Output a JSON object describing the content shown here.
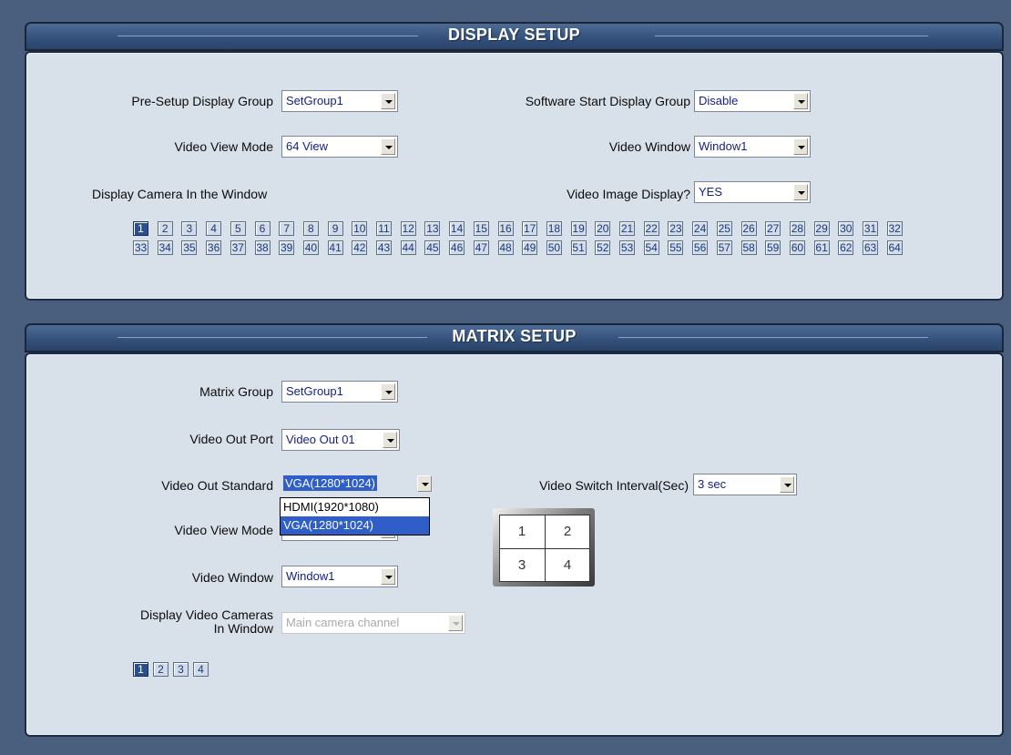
{
  "display_setup": {
    "title": "DISPLAY SETUP",
    "pre_setup_label": "Pre-Setup  Display Group",
    "pre_setup_value": "SetGroup1",
    "software_start_label": "Software Start Display Group",
    "software_start_value": "Disable",
    "video_view_mode_label": "Video View Mode",
    "video_view_mode_value": "64 View",
    "video_window_label": "Video Window",
    "video_window_value": "Window1",
    "display_camera_label": "Display Camera In the Window",
    "video_image_display_label": "Video Image Display?",
    "video_image_display_value": "YES",
    "cameras": [
      "1",
      "2",
      "3",
      "4",
      "5",
      "6",
      "7",
      "8",
      "9",
      "10",
      "11",
      "12",
      "13",
      "14",
      "15",
      "16",
      "17",
      "18",
      "19",
      "20",
      "21",
      "22",
      "23",
      "24",
      "25",
      "26",
      "27",
      "28",
      "29",
      "30",
      "31",
      "32",
      "33",
      "34",
      "35",
      "36",
      "37",
      "38",
      "39",
      "40",
      "41",
      "42",
      "43",
      "44",
      "45",
      "46",
      "47",
      "48",
      "49",
      "50",
      "51",
      "52",
      "53",
      "54",
      "55",
      "56",
      "57",
      "58",
      "59",
      "60",
      "61",
      "62",
      "63",
      "64"
    ],
    "selected_camera": "1"
  },
  "matrix_setup": {
    "title": "MATRIX SETUP",
    "matrix_group_label": "Matrix Group",
    "matrix_group_value": "SetGroup1",
    "video_out_port_label": "Video Out Port",
    "video_out_port_value": "Video Out 01",
    "video_out_standard_label": "Video Out Standard",
    "video_out_standard_value": "VGA(1280*1024)",
    "video_out_standard_options": [
      "HDMI(1920*1080)",
      "VGA(1280*1024)"
    ],
    "video_switch_interval_label": "Video Switch Interval(Sec)",
    "video_switch_interval_value": "3 sec",
    "video_view_mode_label": "Video View Mode",
    "video_window_label": "Video Window",
    "video_window_value": "Window1",
    "display_video_cameras_label_1": "Display Video Cameras",
    "display_video_cameras_label_2": "In Window",
    "display_video_cameras_value": "Main camera channel",
    "quad_cells": [
      "1",
      "2",
      "3",
      "4"
    ],
    "cameras": [
      "1",
      "2",
      "3",
      "4"
    ],
    "selected_camera": "1"
  }
}
